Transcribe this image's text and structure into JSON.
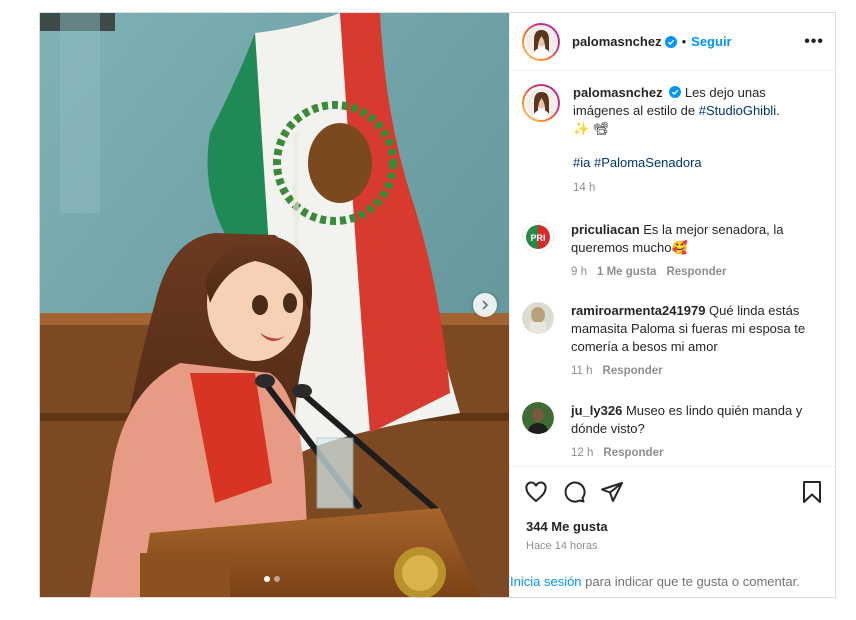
{
  "post": {
    "username": "palomasnchez",
    "follow_label": "Seguir",
    "dot_sep": "•",
    "more_label": "•••",
    "next_label": "›",
    "caption_text": "Les dejo unas imágenes al estilo de ",
    "caption_hashtag": "#StudioGhibli",
    "caption_end": ".",
    "caption_emojis": "✨ 📽",
    "caption_tags": "#ia #PalomaSenadora",
    "caption_time": "14 h",
    "likes": "344 Me gusta",
    "posted_ago": "Hace 14 horas",
    "login_link": "Inicia sesión",
    "login_rest": " para indicar que te gusta o comentar."
  },
  "comments": [
    {
      "user": "priculiacan",
      "text": "Es la mejor senadora, la queremos mucho🥰",
      "time": "9 h",
      "likes": "1 Me gusta",
      "reply": "Responder"
    },
    {
      "user": "ramiroarmenta241979",
      "text": "Qué linda estás mamasita Paloma si fueras mi esposa te comería a besos mi amor",
      "time": "11 h",
      "reply": "Responder"
    },
    {
      "user": "ju_ly326",
      "text": "Museo es lindo quién manda y dónde visto?",
      "time": "12 h",
      "reply": "Responder"
    }
  ],
  "avatar_badge_text": "PRI",
  "carousel": {
    "total": 2,
    "current": 1
  },
  "colors": {
    "accent": "#0095f6",
    "verified": "#0095f6",
    "text": "#262626",
    "muted": "#8e8e8e"
  },
  "icons": [
    "heart-icon",
    "comment-icon",
    "share-icon",
    "bookmark-icon",
    "verified-icon",
    "chevron-right-icon",
    "more-icon"
  ]
}
